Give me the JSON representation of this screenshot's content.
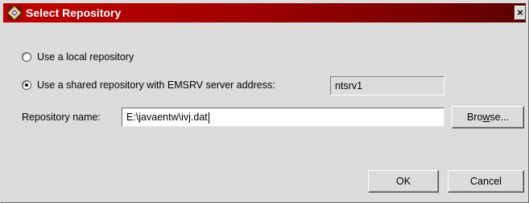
{
  "window": {
    "title": "Select Repository",
    "close_glyph": "×",
    "title_icon": "app-diamond-icon",
    "titlebar_color": "#a00000"
  },
  "options": {
    "local_label": "Use a local repository",
    "local_selected": false,
    "shared_label": "Use a shared repository with EMSRV server address:",
    "shared_selected": true,
    "server_address_value": "ntsrv1"
  },
  "repository": {
    "name_label": "Repository name:",
    "name_value": "E:\\javaentw\\ivj.dat"
  },
  "buttons": {
    "browse_pre": "Bro",
    "browse_mnemonic": "w",
    "browse_post": "se...",
    "ok_label": "OK",
    "cancel_label": "Cancel"
  }
}
